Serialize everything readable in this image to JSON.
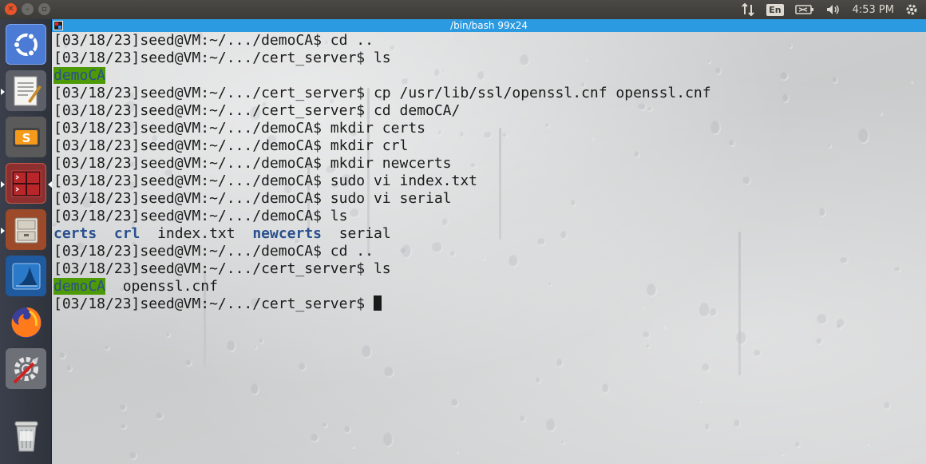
{
  "topbar": {
    "window_buttons": [
      "close-icon",
      "minimize-icon",
      "maximize-icon"
    ],
    "tray": {
      "network_icon": "network-arrows-icon",
      "language": "En",
      "battery_icon": "battery-icon",
      "volume_icon": "volume-icon",
      "time": "4:53 PM",
      "settings_icon": "gear-icon"
    }
  },
  "launcher": {
    "items": [
      {
        "name": "ubuntu-dash",
        "icon": "ubuntu-logo-icon",
        "running": false
      },
      {
        "name": "text-editor",
        "icon": "text-editor-icon",
        "running": true
      },
      {
        "name": "sublime-text",
        "icon": "sublime-text-icon",
        "running": false
      },
      {
        "name": "terminal",
        "icon": "terminal-icon",
        "running": true,
        "active": true
      },
      {
        "name": "file-manager",
        "icon": "file-cabinet-icon",
        "running": true
      },
      {
        "name": "wireshark",
        "icon": "wireshark-fin-icon",
        "running": false
      },
      {
        "name": "firefox",
        "icon": "firefox-icon",
        "running": false
      },
      {
        "name": "system-settings",
        "icon": "settings-tools-icon",
        "running": false
      },
      {
        "name": "trash",
        "icon": "trash-icon",
        "running": false
      }
    ]
  },
  "terminal": {
    "title": "/bin/bash 99x24",
    "lines": [
      {
        "type": "prompt",
        "prompt": "[03/18/23]seed@VM:~/.../demoCA$ ",
        "cmd": "cd .."
      },
      {
        "type": "prompt",
        "prompt": "[03/18/23]seed@VM:~/.../cert_server$ ",
        "cmd": "ls"
      },
      {
        "type": "ls",
        "items": [
          {
            "text": "demoCA",
            "style": "hl"
          }
        ]
      },
      {
        "type": "prompt",
        "prompt": "[03/18/23]seed@VM:~/.../cert_server$ ",
        "cmd": "cp /usr/lib/ssl/openssl.cnf openssl.cnf"
      },
      {
        "type": "prompt",
        "prompt": "[03/18/23]seed@VM:~/.../cert_server$ ",
        "cmd": "cd demoCA/"
      },
      {
        "type": "prompt",
        "prompt": "[03/18/23]seed@VM:~/.../demoCA$ ",
        "cmd": "mkdir certs"
      },
      {
        "type": "prompt",
        "prompt": "[03/18/23]seed@VM:~/.../demoCA$ ",
        "cmd": "mkdir crl"
      },
      {
        "type": "prompt",
        "prompt": "[03/18/23]seed@VM:~/.../demoCA$ ",
        "cmd": "mkdir newcerts"
      },
      {
        "type": "prompt",
        "prompt": "[03/18/23]seed@VM:~/.../demoCA$ ",
        "cmd": "sudo vi index.txt"
      },
      {
        "type": "prompt",
        "prompt": "[03/18/23]seed@VM:~/.../demoCA$ ",
        "cmd": "sudo vi serial"
      },
      {
        "type": "prompt",
        "prompt": "[03/18/23]seed@VM:~/.../demoCA$ ",
        "cmd": "ls"
      },
      {
        "type": "ls",
        "items": [
          {
            "text": "certs",
            "style": "dir"
          },
          {
            "text": "  ",
            "style": ""
          },
          {
            "text": "crl",
            "style": "dir"
          },
          {
            "text": "  ",
            "style": ""
          },
          {
            "text": "index.txt",
            "style": ""
          },
          {
            "text": "  ",
            "style": ""
          },
          {
            "text": "newcerts",
            "style": "dir"
          },
          {
            "text": "  ",
            "style": ""
          },
          {
            "text": "serial",
            "style": ""
          }
        ]
      },
      {
        "type": "prompt",
        "prompt": "[03/18/23]seed@VM:~/.../demoCA$ ",
        "cmd": "cd .."
      },
      {
        "type": "prompt",
        "prompt": "[03/18/23]seed@VM:~/.../cert_server$ ",
        "cmd": "ls"
      },
      {
        "type": "ls",
        "items": [
          {
            "text": "demoCA",
            "style": "hl"
          },
          {
            "text": "  ",
            "style": ""
          },
          {
            "text": "openssl.cnf",
            "style": ""
          }
        ]
      },
      {
        "type": "prompt",
        "prompt": "[03/18/23]seed@VM:~/.../cert_server$ ",
        "cmd": "",
        "cursor": true
      }
    ]
  },
  "colors": {
    "titlebar": "#2c9ae0",
    "directory": "#2a4f8e",
    "highlight_bg": "#4e9a06",
    "text": "#1a1a1a"
  }
}
